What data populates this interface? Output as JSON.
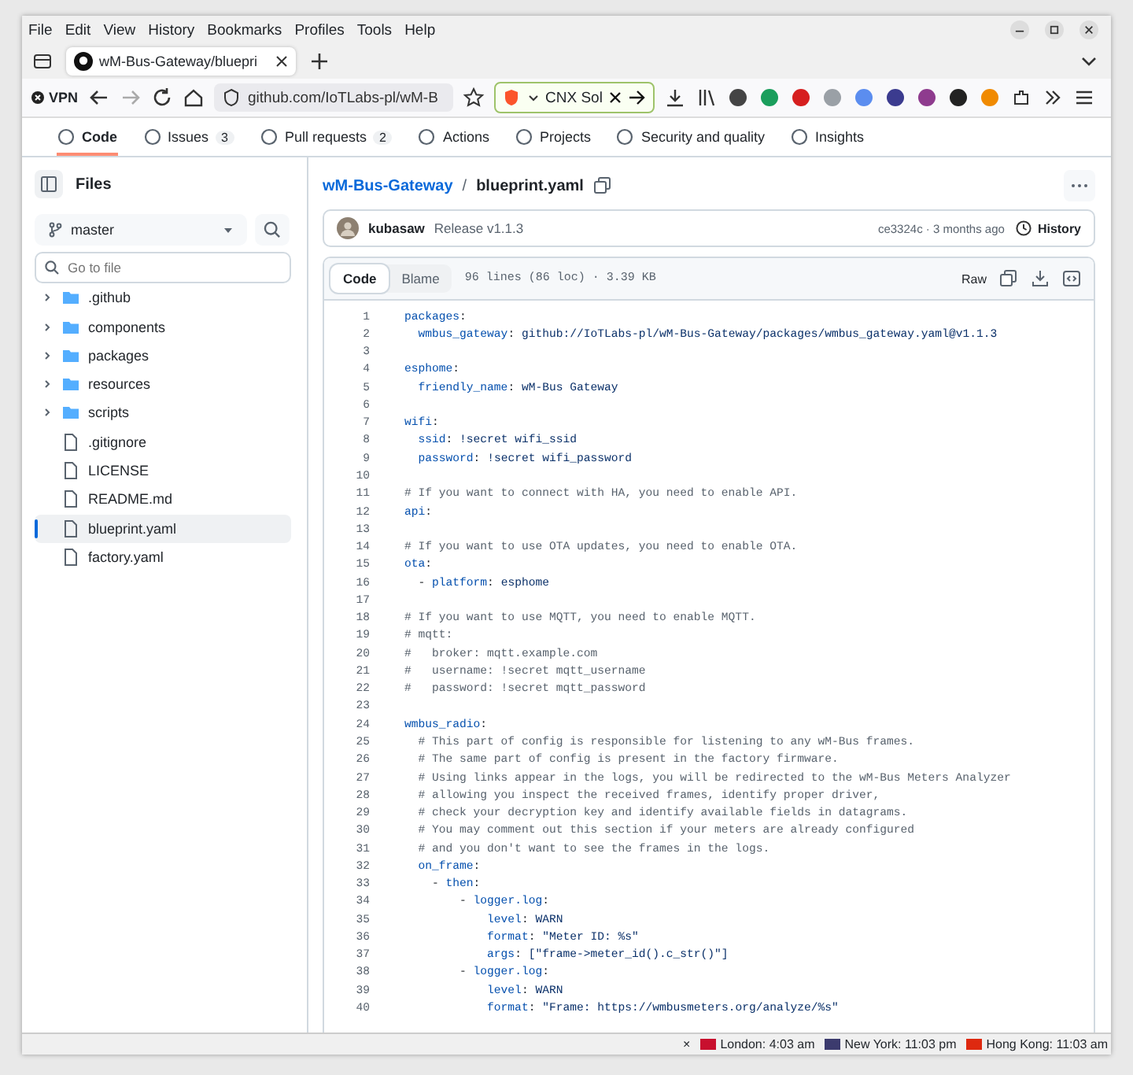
{
  "menu": [
    "File",
    "Edit",
    "View",
    "History",
    "Bookmarks",
    "Profiles",
    "Tools",
    "Help"
  ],
  "tab": {
    "title": "wM-Bus-Gateway/bluepri"
  },
  "nav": {
    "vpn": "VPN",
    "url": "github.com/IoTLabs-pl/wM-B",
    "search": "CNX Sol"
  },
  "repo_tabs": [
    {
      "label": "Code",
      "selected": true
    },
    {
      "label": "Issues",
      "count": "3",
      "selected": false
    },
    {
      "label": "Pull requests",
      "count": "2",
      "selected": false
    },
    {
      "label": "Actions",
      "selected": false
    },
    {
      "label": "Projects",
      "selected": false
    },
    {
      "label": "Security and quality",
      "selected": false
    },
    {
      "label": "Insights",
      "selected": false
    }
  ],
  "sidebar": {
    "title": "Files",
    "branch": "master",
    "filter_placeholder": "Go to file",
    "items": [
      {
        "kind": "folder",
        "name": ".github",
        "selected": false
      },
      {
        "kind": "folder",
        "name": "components",
        "selected": false
      },
      {
        "kind": "folder",
        "name": "packages",
        "selected": false
      },
      {
        "kind": "folder",
        "name": "resources",
        "selected": false
      },
      {
        "kind": "folder",
        "name": "scripts",
        "selected": false
      },
      {
        "kind": "file",
        "name": ".gitignore",
        "selected": false
      },
      {
        "kind": "file",
        "name": "LICENSE",
        "selected": false
      },
      {
        "kind": "file",
        "name": "README.md",
        "selected": false
      },
      {
        "kind": "file",
        "name": "blueprint.yaml",
        "selected": true
      },
      {
        "kind": "file",
        "name": "factory.yaml",
        "selected": false
      }
    ]
  },
  "breadcrumb": {
    "repo": "wM-Bus-Gateway",
    "separator": "/",
    "file": "blueprint.yaml"
  },
  "commit": {
    "author": "kubasaw",
    "message": "Release v1.1.3",
    "meta": "ce3324c · 3 months ago",
    "history": "History"
  },
  "file_header": {
    "views": [
      {
        "label": "Code",
        "selected": true
      },
      {
        "label": "Blame",
        "selected": false
      }
    ],
    "info": "96 lines (86 loc) · 3.39 KB",
    "raw": "Raw"
  },
  "code": [
    {
      "num": "1",
      "tokens": [
        {
          "kind": "key",
          "text": "packages"
        },
        {
          "kind": "punct",
          "text": ":"
        }
      ]
    },
    {
      "num": "2",
      "tokens": [
        {
          "kind": "key",
          "text": "  wmbus_gateway"
        },
        {
          "kind": "punct",
          "text": ": "
        },
        {
          "kind": "value",
          "text": "github://IoTLabs-pl/wM-Bus-Gateway/packages/wmbus_gateway.yaml@v1.1.3"
        }
      ]
    },
    {
      "num": "3"
    },
    {
      "num": "4",
      "tokens": [
        {
          "kind": "key",
          "text": "esphome"
        },
        {
          "kind": "punct",
          "text": ":"
        }
      ]
    },
    {
      "num": "5",
      "tokens": [
        {
          "kind": "key",
          "text": "  friendly_name"
        },
        {
          "kind": "punct",
          "text": ": "
        },
        {
          "kind": "value",
          "text": "wM-Bus Gateway"
        }
      ]
    },
    {
      "num": "6"
    },
    {
      "num": "7",
      "tokens": [
        {
          "kind": "key",
          "text": "wifi"
        },
        {
          "kind": "punct",
          "text": ":"
        }
      ]
    },
    {
      "num": "8",
      "tokens": [
        {
          "kind": "key",
          "text": "  ssid"
        },
        {
          "kind": "punct",
          "text": ": "
        },
        {
          "kind": "value",
          "text": "!secret wifi_ssid"
        }
      ]
    },
    {
      "num": "9",
      "tokens": [
        {
          "kind": "key",
          "text": "  password"
        },
        {
          "kind": "punct",
          "text": ": "
        },
        {
          "kind": "value",
          "text": "!secret wifi_password"
        }
      ]
    },
    {
      "num": "10"
    },
    {
      "num": "11",
      "tokens": [
        {
          "kind": "comment",
          "text": "# If you want to connect with HA, you need to enable API."
        }
      ]
    },
    {
      "num": "12",
      "tokens": [
        {
          "kind": "key",
          "text": "api"
        },
        {
          "kind": "punct",
          "text": ":"
        }
      ]
    },
    {
      "num": "13"
    },
    {
      "num": "14",
      "tokens": [
        {
          "kind": "comment",
          "text": "# If you want to use OTA updates, you need to enable OTA."
        }
      ]
    },
    {
      "num": "15",
      "tokens": [
        {
          "kind": "key",
          "text": "ota"
        },
        {
          "kind": "punct",
          "text": ":"
        }
      ]
    },
    {
      "num": "16",
      "tokens": [
        {
          "kind": "punct",
          "text": "  - "
        },
        {
          "kind": "key",
          "text": "platform"
        },
        {
          "kind": "punct",
          "text": ": "
        },
        {
          "kind": "value",
          "text": "esphome"
        }
      ]
    },
    {
      "num": "17"
    },
    {
      "num": "18",
      "tokens": [
        {
          "kind": "comment",
          "text": "# If you want to use MQTT, you need to enable MQTT."
        }
      ]
    },
    {
      "num": "19",
      "tokens": [
        {
          "kind": "comment",
          "text": "# mqtt:"
        }
      ]
    },
    {
      "num": "20",
      "tokens": [
        {
          "kind": "comment",
          "text": "#   broker: mqtt.example.com"
        }
      ]
    },
    {
      "num": "21",
      "tokens": [
        {
          "kind": "comment",
          "text": "#   username: !secret mqtt_username"
        }
      ]
    },
    {
      "num": "22",
      "tokens": [
        {
          "kind": "comment",
          "text": "#   password: !secret mqtt_password"
        }
      ]
    },
    {
      "num": "23"
    },
    {
      "num": "24",
      "tokens": [
        {
          "kind": "key",
          "text": "wmbus_radio"
        },
        {
          "kind": "punct",
          "text": ":"
        }
      ]
    },
    {
      "num": "25",
      "tokens": [
        {
          "kind": "comment",
          "text": "  # This part of config is responsible for listening to any wM-Bus frames."
        }
      ]
    },
    {
      "num": "26",
      "tokens": [
        {
          "kind": "comment",
          "text": "  # The same part of config is present in the factory firmware."
        }
      ]
    },
    {
      "num": "27",
      "tokens": [
        {
          "kind": "comment",
          "text": "  # Using links appear in the logs, you will be redirected to the wM-Bus Meters Analyzer"
        }
      ]
    },
    {
      "num": "28",
      "tokens": [
        {
          "kind": "comment",
          "text": "  # allowing you inspect the received frames, identify proper driver,"
        }
      ]
    },
    {
      "num": "29",
      "tokens": [
        {
          "kind": "comment",
          "text": "  # check your decryption key and identify available fields in datagrams."
        }
      ]
    },
    {
      "num": "30",
      "tokens": [
        {
          "kind": "comment",
          "text": "  # You may comment out this section if your meters are already configured"
        }
      ]
    },
    {
      "num": "31",
      "tokens": [
        {
          "kind": "comment",
          "text": "  # and you don't want to see the frames in the logs."
        }
      ]
    },
    {
      "num": "32",
      "tokens": [
        {
          "kind": "key",
          "text": "  on_frame"
        },
        {
          "kind": "punct",
          "text": ":"
        }
      ]
    },
    {
      "num": "33",
      "tokens": [
        {
          "kind": "punct",
          "text": "    - "
        },
        {
          "kind": "key",
          "text": "then"
        },
        {
          "kind": "punct",
          "text": ":"
        }
      ]
    },
    {
      "num": "34",
      "tokens": [
        {
          "kind": "punct",
          "text": "        - "
        },
        {
          "kind": "key",
          "text": "logger.log"
        },
        {
          "kind": "punct",
          "text": ":"
        }
      ]
    },
    {
      "num": "35",
      "tokens": [
        {
          "kind": "key",
          "text": "            level"
        },
        {
          "kind": "punct",
          "text": ": "
        },
        {
          "kind": "value",
          "text": "WARN"
        }
      ]
    },
    {
      "num": "36",
      "tokens": [
        {
          "kind": "key",
          "text": "            format"
        },
        {
          "kind": "punct",
          "text": ": "
        },
        {
          "kind": "value",
          "text": "\"Meter ID: %s\""
        }
      ]
    },
    {
      "num": "37",
      "tokens": [
        {
          "kind": "key",
          "text": "            args"
        },
        {
          "kind": "punct",
          "text": ": "
        },
        {
          "kind": "value",
          "text": "[\"frame->meter_id().c_str()\"]"
        }
      ]
    },
    {
      "num": "38",
      "tokens": [
        {
          "kind": "punct",
          "text": "        - "
        },
        {
          "kind": "key",
          "text": "logger.log"
        },
        {
          "kind": "punct",
          "text": ":"
        }
      ]
    },
    {
      "num": "39",
      "tokens": [
        {
          "kind": "key",
          "text": "            level"
        },
        {
          "kind": "punct",
          "text": ": "
        },
        {
          "kind": "value",
          "text": "WARN"
        }
      ]
    },
    {
      "num": "40",
      "tokens": [
        {
          "kind": "key",
          "text": "            format"
        },
        {
          "kind": "punct",
          "text": ": "
        },
        {
          "kind": "value",
          "text": "\"Frame: https://wmbusmeters.org/analyze/%s\""
        }
      ]
    }
  ],
  "status_bar": {
    "close": "×",
    "clocks": [
      {
        "text": "London: 4:03 am",
        "color": "#c8102e"
      },
      {
        "text": "New York: 11:03 pm",
        "color": "#3c3b6e"
      },
      {
        "text": "Hong Kong: 11:03 am",
        "color": "#de2910"
      }
    ]
  }
}
